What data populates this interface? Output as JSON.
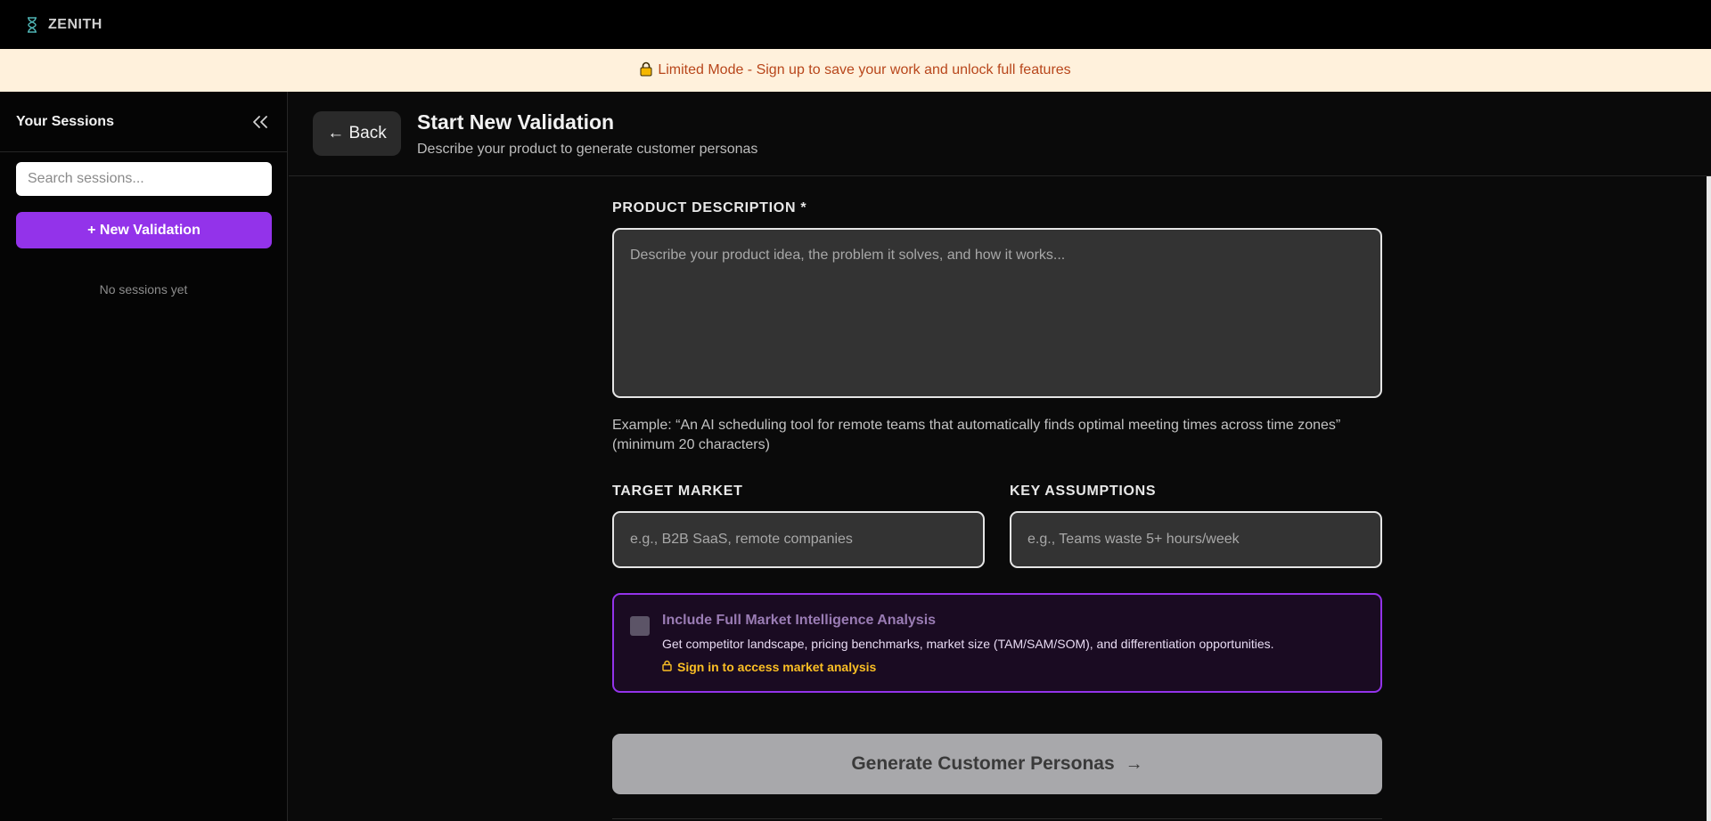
{
  "app": {
    "name": "ZENITH"
  },
  "banner": {
    "text": "Limited Mode - Sign up to save your work and unlock full features"
  },
  "sidebar": {
    "title": "Your Sessions",
    "search_placeholder": "Search sessions...",
    "new_button": "+ New Validation",
    "empty_text": "No sessions yet"
  },
  "header": {
    "back_label": "← Back",
    "title": "Start New Validation",
    "subtitle": "Describe your product to generate customer personas"
  },
  "form": {
    "product_label": "PRODUCT DESCRIPTION *",
    "product_placeholder": "Describe your product idea, the problem it solves, and how it works...",
    "example_text": "Example: “An AI scheduling tool for remote teams that automatically finds optimal meeting times across time zones”",
    "min_text": "(minimum 20 characters)",
    "target_label": "TARGET MARKET",
    "target_placeholder": "e.g., B2B SaaS, remote companies",
    "assumptions_label": "KEY ASSUMPTIONS",
    "assumptions_placeholder": "e.g., Teams waste 5+ hours/week"
  },
  "market": {
    "title": "Include Full Market Intelligence Analysis",
    "description": "Get competitor landscape, pricing benchmarks, market size (TAM/SAM/SOM), and differentiation opportunities.",
    "lock_text": "Sign in to access market analysis",
    "checked": false
  },
  "generate": {
    "label": "Generate Customer Personas",
    "arrow": "→"
  },
  "colors": {
    "accent": "#9333ea",
    "banner_bg": "#fff1dc",
    "banner_text": "#b8461b",
    "lock_text": "#fbbf24"
  }
}
